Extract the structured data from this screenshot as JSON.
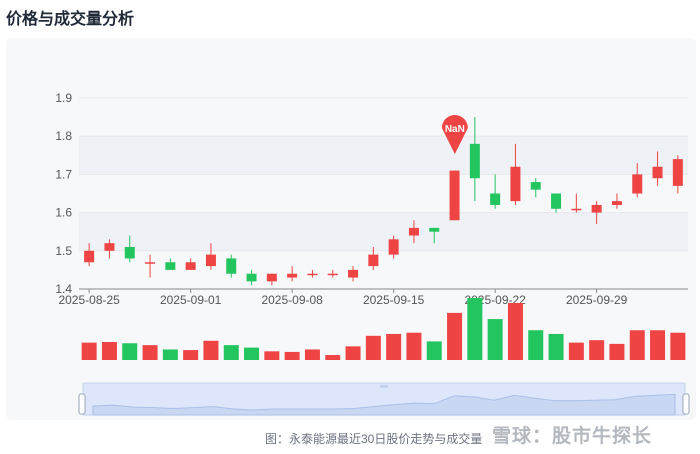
{
  "title": "价格与成交量分析",
  "caption": "图：永泰能源最近30日股价走势与成交量",
  "watermark": "雪球：股市牛探长",
  "colors": {
    "up": "#ef4444",
    "down": "#22c55e",
    "grid": "#e5e7eb",
    "band": "#eef1f6",
    "axis": "#555555"
  },
  "chart_data": {
    "type": "candlestick",
    "ylim": [
      1.4,
      1.9
    ],
    "y_ticks": [
      "1.4",
      "1.5",
      "1.6",
      "1.7",
      "1.8",
      "1.9"
    ],
    "x_ticks": [
      "2025-08-25",
      "2025-09-01",
      "2025-09-08",
      "2025-09-15",
      "2025-09-22",
      "2025-09-29"
    ],
    "marker_label": "NaN",
    "candles": [
      {
        "date": "2025-08-25",
        "open": 1.47,
        "close": 1.5,
        "low": 1.46,
        "high": 1.52,
        "volume": 0.28
      },
      {
        "date": "2025-08-26",
        "open": 1.5,
        "close": 1.52,
        "low": 1.48,
        "high": 1.53,
        "volume": 0.29
      },
      {
        "date": "2025-08-27",
        "open": 1.51,
        "close": 1.48,
        "low": 1.47,
        "high": 1.54,
        "volume": 0.27
      },
      {
        "date": "2025-08-28",
        "open": 1.47,
        "close": 1.47,
        "low": 1.43,
        "high": 1.49,
        "volume": 0.24
      },
      {
        "date": "2025-08-29",
        "open": 1.47,
        "close": 1.45,
        "low": 1.45,
        "high": 1.48,
        "volume": 0.17
      },
      {
        "date": "2025-09-01",
        "open": 1.45,
        "close": 1.47,
        "low": 1.45,
        "high": 1.48,
        "volume": 0.16
      },
      {
        "date": "2025-09-02",
        "open": 1.46,
        "close": 1.49,
        "low": 1.45,
        "high": 1.52,
        "volume": 0.31
      },
      {
        "date": "2025-09-03",
        "open": 1.48,
        "close": 1.44,
        "low": 1.43,
        "high": 1.49,
        "volume": 0.24
      },
      {
        "date": "2025-09-04",
        "open": 1.44,
        "close": 1.42,
        "low": 1.41,
        "high": 1.45,
        "volume": 0.2
      },
      {
        "date": "2025-09-05",
        "open": 1.42,
        "close": 1.44,
        "low": 1.41,
        "high": 1.44,
        "volume": 0.14
      },
      {
        "date": "2025-09-08",
        "open": 1.43,
        "close": 1.44,
        "low": 1.42,
        "high": 1.46,
        "volume": 0.13
      },
      {
        "date": "2025-09-09",
        "open": 1.44,
        "close": 1.44,
        "low": 1.43,
        "high": 1.45,
        "volume": 0.17
      },
      {
        "date": "2025-09-10",
        "open": 1.44,
        "close": 1.44,
        "low": 1.43,
        "high": 1.45,
        "volume": 0.08
      },
      {
        "date": "2025-09-11",
        "open": 1.43,
        "close": 1.45,
        "low": 1.42,
        "high": 1.46,
        "volume": 0.22
      },
      {
        "date": "2025-09-12",
        "open": 1.46,
        "close": 1.49,
        "low": 1.45,
        "high": 1.51,
        "volume": 0.39
      },
      {
        "date": "2025-09-15",
        "open": 1.49,
        "close": 1.53,
        "low": 1.48,
        "high": 1.54,
        "volume": 0.42
      },
      {
        "date": "2025-09-16",
        "open": 1.54,
        "close": 1.56,
        "low": 1.52,
        "high": 1.58,
        "volume": 0.44
      },
      {
        "date": "2025-09-17",
        "open": 1.56,
        "close": 1.55,
        "low": 1.52,
        "high": 1.56,
        "volume": 0.3
      },
      {
        "date": "2025-09-18",
        "open": 1.58,
        "close": 1.71,
        "low": 1.58,
        "high": 1.71,
        "volume": 0.76
      },
      {
        "date": "2025-09-19",
        "open": 1.78,
        "close": 1.69,
        "low": 1.63,
        "high": 1.85,
        "volume": 1.0
      },
      {
        "date": "2025-09-22",
        "open": 1.65,
        "close": 1.62,
        "low": 1.61,
        "high": 1.7,
        "volume": 0.66
      },
      {
        "date": "2025-09-23",
        "open": 1.63,
        "close": 1.72,
        "low": 1.62,
        "high": 1.78,
        "volume": 0.92
      },
      {
        "date": "2025-09-24",
        "open": 1.68,
        "close": 1.66,
        "low": 1.64,
        "high": 1.69,
        "volume": 0.48
      },
      {
        "date": "2025-09-25",
        "open": 1.65,
        "close": 1.61,
        "low": 1.6,
        "high": 1.65,
        "volume": 0.42
      },
      {
        "date": "2025-09-26",
        "open": 1.61,
        "close": 1.61,
        "low": 1.6,
        "high": 1.65,
        "volume": 0.28
      },
      {
        "date": "2025-09-29",
        "open": 1.6,
        "close": 1.62,
        "low": 1.57,
        "high": 1.63,
        "volume": 0.32
      },
      {
        "date": "2025-09-30",
        "open": 1.62,
        "close": 1.63,
        "low": 1.61,
        "high": 1.65,
        "volume": 0.26
      },
      {
        "date": "2025-10-01",
        "open": 1.65,
        "close": 1.7,
        "low": 1.64,
        "high": 1.73,
        "volume": 0.48
      },
      {
        "date": "2025-10-02",
        "open": 1.69,
        "close": 1.72,
        "low": 1.67,
        "high": 1.76,
        "volume": 0.48
      },
      {
        "date": "2025-10-03",
        "open": 1.67,
        "close": 1.74,
        "low": 1.65,
        "high": 1.75,
        "volume": 0.44
      }
    ]
  }
}
